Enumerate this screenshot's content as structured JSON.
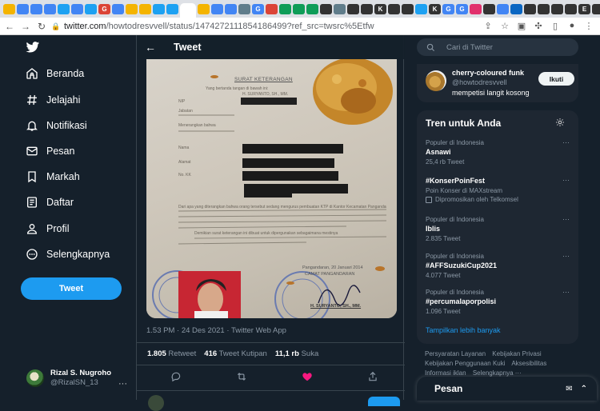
{
  "browser": {
    "url_main": "twitter.com",
    "url_rest": "/howtodresvvell/status/1474272111854186499?ref_src=twsrc%5Etfw",
    "tab_favicons": [
      {
        "letter": "",
        "color": "#f4b400"
      },
      {
        "letter": "",
        "color": "#4285f4"
      },
      {
        "letter": "",
        "color": "#4285f4"
      },
      {
        "letter": "",
        "color": "#4285f4"
      },
      {
        "letter": "",
        "color": "#1da1f2"
      },
      {
        "letter": "",
        "color": "#4285f4"
      },
      {
        "letter": "",
        "color": "#1da1f2"
      },
      {
        "letter": "G",
        "color": "#db4437"
      },
      {
        "letter": "",
        "color": "#4285f4"
      },
      {
        "letter": "",
        "color": "#f4b400"
      },
      {
        "letter": "",
        "color": "#f4b400"
      },
      {
        "letter": "",
        "color": "#1da1f2"
      },
      {
        "letter": "",
        "color": "#1da1f2"
      },
      {
        "letter": "",
        "color": "#f4b400"
      },
      {
        "letter": "",
        "color": "#f4b400"
      },
      {
        "letter": "",
        "color": "#4285f4"
      },
      {
        "letter": "",
        "color": "#4285f4"
      },
      {
        "letter": "",
        "color": "#607d8b"
      },
      {
        "letter": "G",
        "color": "#4285f4"
      },
      {
        "letter": "",
        "color": "#db4437"
      },
      {
        "letter": "",
        "color": "#0f9d58"
      },
      {
        "letter": "",
        "color": "#0f9d58"
      },
      {
        "letter": "",
        "color": "#0f9d58"
      },
      {
        "letter": "",
        "color": "#333333"
      },
      {
        "letter": "",
        "color": "#607d8b"
      },
      {
        "letter": "",
        "color": "#333333"
      },
      {
        "letter": "",
        "color": "#333333"
      },
      {
        "letter": "K",
        "color": "#333333"
      },
      {
        "letter": "",
        "color": "#333333"
      },
      {
        "letter": "",
        "color": "#333333"
      },
      {
        "letter": "",
        "color": "#1da1f2"
      },
      {
        "letter": "K",
        "color": "#333333"
      },
      {
        "letter": "G",
        "color": "#4285f4"
      },
      {
        "letter": "G",
        "color": "#4285f4"
      },
      {
        "letter": "",
        "color": "#e1306c"
      },
      {
        "letter": "",
        "color": "#333333"
      },
      {
        "letter": "",
        "color": "#4285f4"
      },
      {
        "letter": "",
        "color": "#0a66c2"
      },
      {
        "letter": "",
        "color": "#333333"
      },
      {
        "letter": "",
        "color": "#333333"
      },
      {
        "letter": "",
        "color": "#333333"
      },
      {
        "letter": "",
        "color": "#333333"
      },
      {
        "letter": "E",
        "color": "#333333"
      },
      {
        "letter": "",
        "color": "#333333"
      },
      {
        "letter": "",
        "color": "#0f9d58"
      },
      {
        "letter": "",
        "color": "#4285f4"
      },
      {
        "letter": "",
        "color": "#4285f4"
      },
      {
        "letter": "",
        "color": "#4285f4"
      },
      {
        "letter": "G",
        "color": "#db4437"
      },
      {
        "letter": "",
        "color": "#4285f4"
      },
      {
        "letter": "",
        "color": "#4285f4"
      },
      {
        "letter": "W",
        "color": "#333333"
      },
      {
        "letter": "",
        "color": "#db4437"
      },
      {
        "letter": "",
        "color": "#607d8b"
      },
      {
        "letter": "",
        "color": "#1da1f2"
      },
      {
        "letter": "G",
        "color": "#4285f4"
      },
      {
        "letter": "W",
        "color": "#333333"
      },
      {
        "letter": "",
        "color": "#4285f4"
      }
    ]
  },
  "sidebar": {
    "items": [
      {
        "label": "Beranda",
        "icon": "home-icon"
      },
      {
        "label": "Jelajahi",
        "icon": "hashtag-icon"
      },
      {
        "label": "Notifikasi",
        "icon": "bell-icon"
      },
      {
        "label": "Pesan",
        "icon": "mail-icon"
      },
      {
        "label": "Markah",
        "icon": "bookmark-icon"
      },
      {
        "label": "Daftar",
        "icon": "list-icon"
      },
      {
        "label": "Profil",
        "icon": "person-icon"
      },
      {
        "label": "Selengkapnya",
        "icon": "more-circle-icon"
      }
    ],
    "tweet_button": "Tweet",
    "user": {
      "name": "Rizal S. Nugroho",
      "handle": "@RizalSN_13"
    }
  },
  "main": {
    "header_title": "Tweet",
    "meta": "1.53 PM · 24 Des 2021 · Twitter Web App",
    "stats": {
      "retweets_value": "1.805",
      "retweets_label": "Retweet",
      "quotes_value": "416",
      "quotes_label": "Tweet Kutipan",
      "likes_value": "11,1 rb",
      "likes_label": "Suka"
    },
    "document_text": {
      "heading": "SURAT KETERANGAN",
      "line1": "Yang bertanda tangan di bawah ini:",
      "line2": "H. SURYANTO, SH., MM.",
      "line3": "NIP",
      "line4": "Jabatan",
      "line5": "Menerangkan bahwa",
      "line6": "Nama",
      "line7": "Alamat",
      "line8": "No. KK",
      "para": "Dari apa yang diterangkan bahwa orang tersebut sedang mengurus pembuatan KTP di Kantor Kecamatan Pangandaran",
      "close": "Demikian surat keterangan ini dibuat untuk dipergunakan sebagaimana mestinya",
      "date": "Pangandaran, 20 Januari 2014",
      "office": "CAMAT PANGANDARAN",
      "signer": "H. SURYANTO, SH., MM."
    }
  },
  "right": {
    "search_placeholder": "Cari di Twitter",
    "account": {
      "name": "cherry-coloured funk",
      "handle": "@howtodresvvell",
      "desc": "mempetisi langit kosong",
      "follow": "Ikuti"
    },
    "trends_title": "Tren untuk Anda",
    "trends": [
      {
        "context": "Populer di Indonesia",
        "title": "Asnawi",
        "sub": "25,4 rb Tweet",
        "promo": false
      },
      {
        "context": "",
        "title": "#KonserPoinFest",
        "sub": "Poin Konser di MAXstream",
        "promo": true,
        "promo_text": "Dipromosikan oleh Telkomsel"
      },
      {
        "context": "Populer di Indonesia",
        "title": "Iblis",
        "sub": "2.835 Tweet",
        "promo": false
      },
      {
        "context": "Populer di Indonesia",
        "title": "#AFFSuzukiCup2021",
        "sub": "4.077 Tweet",
        "promo": false
      },
      {
        "context": "Populer di Indonesia",
        "title": "#percumalaporpolisi",
        "sub": "1.096 Tweet",
        "promo": false
      }
    ],
    "show_more": "Tampilkan lebih banyak",
    "footer_links": [
      "Persyaratan Layanan",
      "Kebijakan Privasi",
      "Kebijakan Penggunaan Kuki",
      "Aksesibilitas",
      "Informasi iklan",
      "Selengkapnya ···"
    ],
    "messages_label": "Pesan"
  }
}
